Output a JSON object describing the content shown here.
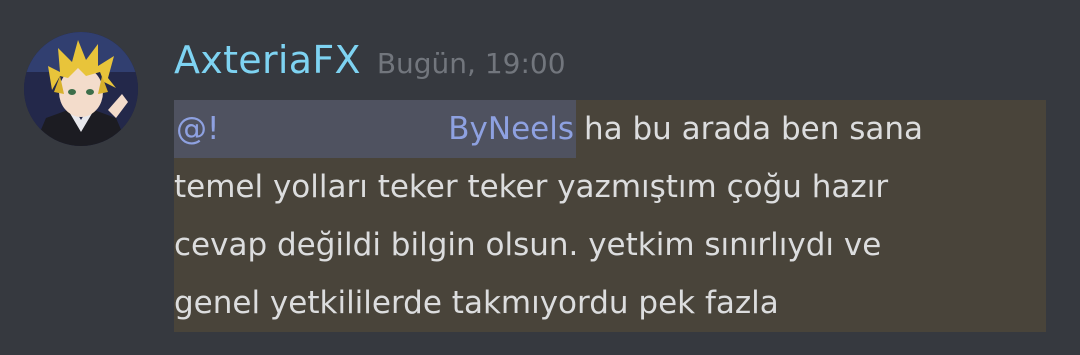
{
  "message": {
    "username": "AxteriaFX",
    "timestamp": "Bugün, 19:00",
    "mention_prefix": "@!",
    "mention_name": "ByNeels",
    "lines": [
      "ha bu arada ben sana",
      "temel yolları teker teker yazmıştım çoğu hazır",
      "cevap değildi bilgin olsun. yetkim sınırlıydı ve",
      "genel yetkililerde takmıyordu pek fazla"
    ]
  },
  "colors": {
    "background": "#36393f",
    "username": "#7ed3f2",
    "timestamp": "#72767d",
    "message_text": "#dcddde",
    "mention_text": "#8ea1e1",
    "mention_bg": "#4f5260",
    "highlight_bg": "#49443a"
  },
  "icons": {
    "avatar": "anime-character-avatar"
  }
}
